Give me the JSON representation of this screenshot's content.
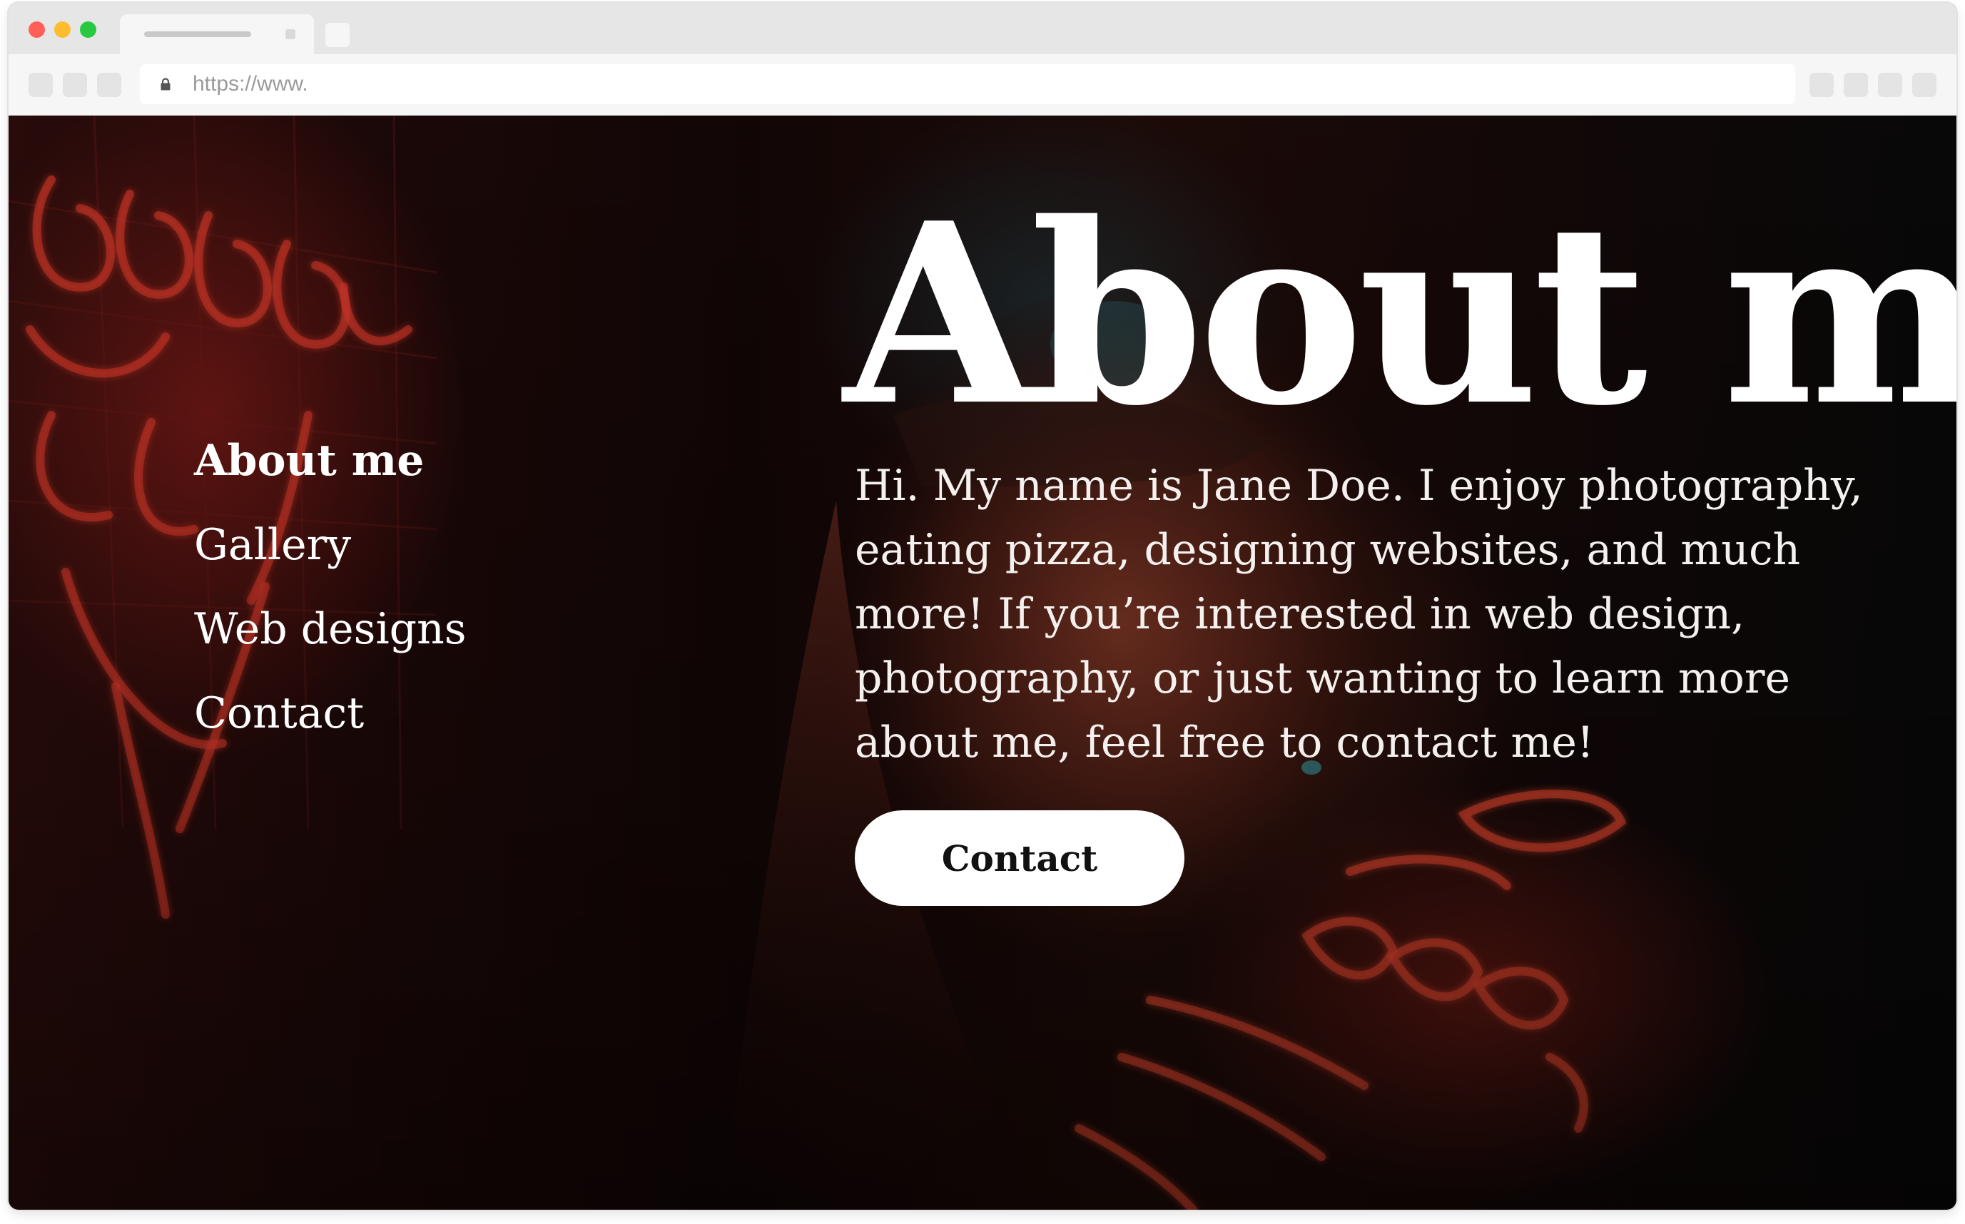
{
  "browser": {
    "url": "https://www."
  },
  "nav": {
    "items": [
      {
        "label": "About me",
        "active": true
      },
      {
        "label": "Gallery",
        "active": false
      },
      {
        "label": "Web designs",
        "active": false
      },
      {
        "label": "Contact",
        "active": false
      }
    ]
  },
  "hero": {
    "title": "About me",
    "description": "Hi. My name is Jane Doe. I enjoy photography, eating pizza, designing websites, and much more! If you’re interested in web design, photography, or just wanting to learn more about me, feel free to contact me!",
    "cta_label": "Contact"
  },
  "colors": {
    "traffic_red": "#ff5f57",
    "traffic_yellow": "#febc2e",
    "traffic_green": "#28c840",
    "neon_red": "#d9382c",
    "text": "#ffffff",
    "button_bg": "#ffffff",
    "button_text": "#111111"
  }
}
